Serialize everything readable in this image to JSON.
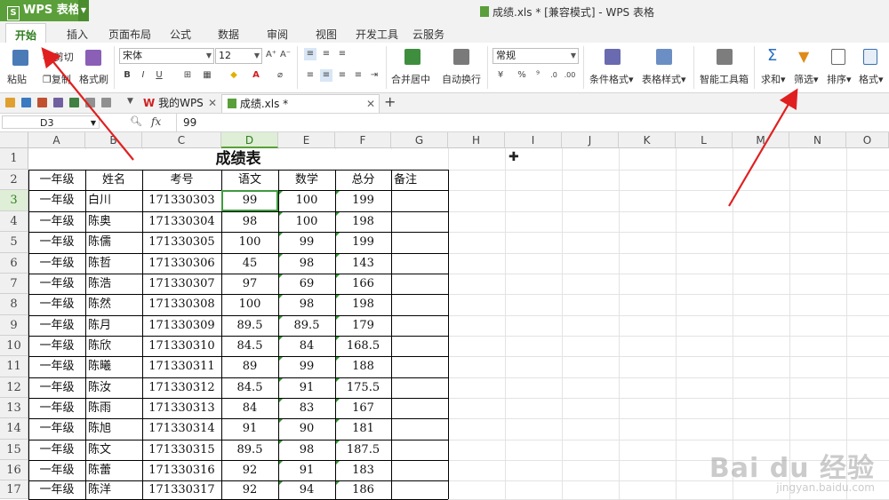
{
  "app": {
    "brand": "WPS 表格",
    "doc_title": "成绩.xls * [兼容模式] - WPS 表格"
  },
  "menu": {
    "tabs": [
      "开始",
      "插入",
      "页面布局",
      "公式",
      "数据",
      "审阅",
      "视图",
      "开发工具",
      "云服务"
    ],
    "active": "开始"
  },
  "ribbon": {
    "paste": "粘贴",
    "cut": "剪切",
    "copy": "复制",
    "format_painter": "格式刷",
    "font_name": "宋体",
    "font_size": "12",
    "merge_center": "合并居中",
    "wrap_text": "自动换行",
    "number_format": "常规",
    "conditional_format": "条件格式",
    "table_style": "表格样式",
    "smart_toolbox": "智能工具箱",
    "sum": "求和",
    "filter": "筛选",
    "sort": "排序",
    "format": "格式"
  },
  "tabs_bar": {
    "my_wps": "我的WPS",
    "file_tab": "成绩.xls *",
    "new_tab": "+"
  },
  "formula_bar": {
    "name_box": "D3",
    "fx": "fx",
    "value": "99"
  },
  "columns": [
    "A",
    "B",
    "C",
    "D",
    "E",
    "F",
    "G",
    "H",
    "I",
    "J",
    "K",
    "L",
    "M",
    "N",
    "O"
  ],
  "sheet": {
    "title": "成绩表",
    "headers": [
      "一年级",
      "姓名",
      "考号",
      "语文",
      "数学",
      "总分",
      "备注"
    ],
    "rows": [
      [
        "一年级",
        "白川",
        "171330303",
        "99",
        "100",
        "199"
      ],
      [
        "一年级",
        "陈奥",
        "171330304",
        "98",
        "100",
        "198"
      ],
      [
        "一年级",
        "陈儒",
        "171330305",
        "100",
        "99",
        "199"
      ],
      [
        "一年级",
        "陈哲",
        "171330306",
        "45",
        "98",
        "143"
      ],
      [
        "一年级",
        "陈浩",
        "171330307",
        "97",
        "69",
        "166"
      ],
      [
        "一年级",
        "陈然",
        "171330308",
        "100",
        "98",
        "198"
      ],
      [
        "一年级",
        "陈月",
        "171330309",
        "89.5",
        "89.5",
        "179"
      ],
      [
        "一年级",
        "陈欣",
        "171330310",
        "84.5",
        "84",
        "168.5"
      ],
      [
        "一年级",
        "陈曦",
        "171330311",
        "89",
        "99",
        "188"
      ],
      [
        "一年级",
        "陈汝",
        "171330312",
        "84.5",
        "91",
        "175.5"
      ],
      [
        "一年级",
        "陈雨",
        "171330313",
        "84",
        "83",
        "167"
      ],
      [
        "一年级",
        "陈旭",
        "171330314",
        "91",
        "90",
        "181"
      ],
      [
        "一年级",
        "陈文",
        "171330315",
        "89.5",
        "98",
        "187.5"
      ],
      [
        "一年级",
        "陈蕾",
        "171330316",
        "92",
        "91",
        "183"
      ],
      [
        "一年级",
        "陈洋",
        "171330317",
        "92",
        "94",
        "186"
      ]
    ],
    "row_numbers": [
      "1",
      "2",
      "3",
      "4",
      "5",
      "6",
      "7",
      "8",
      "9",
      "10",
      "11",
      "12",
      "13",
      "14",
      "15",
      "16",
      "17"
    ],
    "selected_cell": "D3"
  },
  "watermark": {
    "brand": "Bai du 经验",
    "url": "jingyan.baidu.com"
  },
  "colors": {
    "accent": "#5a9f3a",
    "arrow": "#e02020"
  }
}
